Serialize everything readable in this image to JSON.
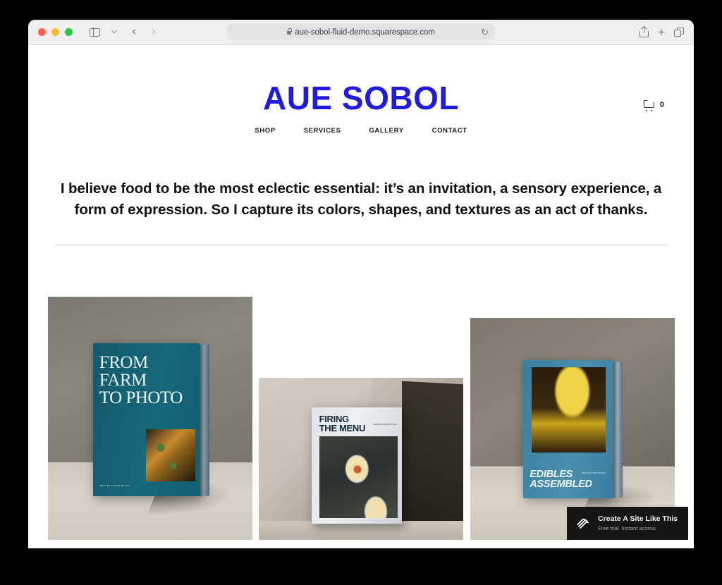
{
  "browser": {
    "url": "aue-sobol-fluid-demo.squarespace.com",
    "back_glyph": "‹",
    "forward_glyph": "›",
    "reload_glyph": "↻",
    "plus_glyph": "+"
  },
  "site": {
    "logo": "AUE SOBOL",
    "logo_color": "#1f1be0",
    "nav": [
      {
        "label": "SHOP"
      },
      {
        "label": "SERVICES"
      },
      {
        "label": "GALLERY"
      },
      {
        "label": "CONTACT"
      }
    ],
    "cart_count": "0",
    "headline": "I believe food to be the most eclectic essential: it’s an invitation, a sensory experience, a form of expression. So I capture its colors, shapes, and textures as an act of thanks."
  },
  "gallery": [
    {
      "title_line1": "FROM FARM",
      "title_line2": "TO PHOTO",
      "credit": "WRITTEN & SHOT BY S.B.L."
    },
    {
      "title_line1": "FIRING",
      "title_line2": "THE MENU",
      "credit": "WRITTEN & SHOT BY S.B.L."
    },
    {
      "title_line1": "EDIBLES",
      "title_line2": "ASSEMBLED",
      "credit": "WRITTEN & SHOT BY S.B.L."
    }
  ],
  "promo": {
    "title": "Create A Site Like This",
    "subtitle": "Free trial. Instant access."
  }
}
